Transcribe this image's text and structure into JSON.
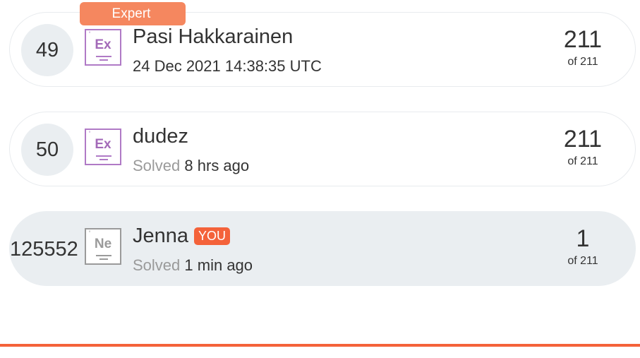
{
  "rows": [
    {
      "rank": "49",
      "badge": {
        "number": "'",
        "symbol": "Ex"
      },
      "name": "Pasi Hakkarainen",
      "ribbon": "Expert",
      "subtitle_prefix": "",
      "subtitle_value": "24 Dec 2021 14:38:35 UTC",
      "score": "211",
      "score_of": "of 211"
    },
    {
      "rank": "50",
      "badge": {
        "number": "'",
        "symbol": "Ex"
      },
      "name": "dudez",
      "subtitle_prefix": "Solved",
      "subtitle_value": "8 hrs ago",
      "score": "211",
      "score_of": "of 211"
    },
    {
      "rank": "125552",
      "badge": {
        "number": "'",
        "symbol": "Ne"
      },
      "name": "Jenna",
      "you_tag": "YOU",
      "subtitle_prefix": "Solved",
      "subtitle_value": "1 min ago",
      "score": "1",
      "score_of": "of 211"
    }
  ],
  "colors": {
    "accent": "#f4623a",
    "expert_ribbon": "#f5875f",
    "badge_expert": "#b07ac6",
    "badge_newbie": "#9a9a9a",
    "current_row_bg": "#eaeef1"
  }
}
